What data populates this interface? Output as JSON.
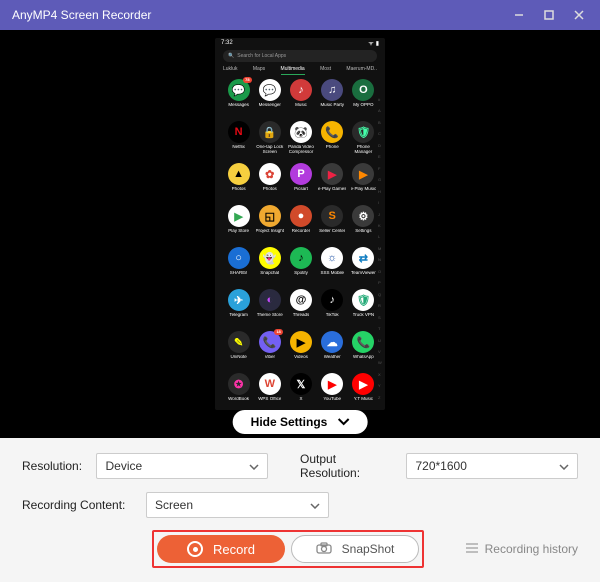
{
  "titlebar": {
    "title": "AnyMP4 Screen Recorder"
  },
  "phone": {
    "time": "7:32",
    "search_placeholder": "Search for Local Apps",
    "tabs": [
      "Lukluk",
      "Maps",
      "Multimedia",
      "Most",
      "Maerum-MD.."
    ],
    "active_tab": 2,
    "alpha_index": [
      "#",
      "A",
      "B",
      "C",
      "D",
      "E",
      "F",
      "G",
      "H",
      "I",
      "J",
      "K",
      "L",
      "M",
      "N",
      "O",
      "P",
      "Q",
      "R",
      "S",
      "T",
      "U",
      "V",
      "W",
      "X",
      "Y",
      "Z"
    ],
    "apps": [
      {
        "label": "Messages",
        "bg": "#1a9a4a",
        "txt": "💬",
        "badge": "78"
      },
      {
        "label": "Messenger",
        "bg": "#fff",
        "txt": "💬",
        "fg": "#1778f2"
      },
      {
        "label": "Music",
        "bg": "#d13a3a",
        "txt": "♪"
      },
      {
        "label": "Music Party",
        "bg": "#4a4a7e",
        "txt": "♫"
      },
      {
        "label": "My OPPO",
        "bg": "#1a6e3f",
        "txt": "O"
      },
      {
        "label": "Netflix",
        "bg": "#000",
        "txt": "N",
        "fg": "#e50914"
      },
      {
        "label": "One-tap Lock Screen",
        "bg": "#2a2a2a",
        "txt": "🔒"
      },
      {
        "label": "Panda Video Compressor",
        "bg": "#fff",
        "txt": "🐼",
        "fg": "#000"
      },
      {
        "label": "Phone",
        "bg": "#f6b400",
        "txt": "📞",
        "fg": "#000"
      },
      {
        "label": "Phone Manager",
        "bg": "#2a2a2a",
        "txt": "🛡",
        "fg": "#4fa"
      },
      {
        "label": "Photos",
        "bg": "#f6cf3f",
        "txt": "▲",
        "fg": "#000"
      },
      {
        "label": "Photos",
        "bg": "#fff",
        "txt": "✿",
        "fg": "#db4437"
      },
      {
        "label": "Picsart",
        "bg": "#b23bdd",
        "txt": "P"
      },
      {
        "label": "e·Play Games",
        "bg": "#3a3a3a",
        "txt": "▶",
        "fg": "#e24"
      },
      {
        "label": "e·Play Music",
        "bg": "#3a3a3a",
        "txt": "▶",
        "fg": "#f80"
      },
      {
        "label": "Play Store",
        "bg": "#fff",
        "txt": "▶",
        "fg": "#34a853"
      },
      {
        "label": "Project Insight",
        "bg": "#f0a930",
        "txt": "◱",
        "fg": "#000"
      },
      {
        "label": "Recorder",
        "bg": "#d14a2a",
        "txt": "●"
      },
      {
        "label": "Seller Center",
        "bg": "#2a2a2a",
        "txt": "S",
        "fg": "#f80"
      },
      {
        "label": "Settings",
        "bg": "#3a3a3a",
        "txt": "⚙"
      },
      {
        "label": "SHAREit",
        "bg": "#1a6ed4",
        "txt": "○"
      },
      {
        "label": "Snapchat",
        "bg": "#fffc00",
        "txt": "👻",
        "fg": "#000"
      },
      {
        "label": "Spotify",
        "bg": "#1db954",
        "txt": "♪",
        "fg": "#000"
      },
      {
        "label": "SSS Mobile",
        "bg": "#fff",
        "txt": "☼",
        "fg": "#1a4ea3"
      },
      {
        "label": "TeamViewer",
        "bg": "#fff",
        "txt": "⇄",
        "fg": "#0e7cc1"
      },
      {
        "label": "Telegram",
        "bg": "#2aa1da",
        "txt": "✈"
      },
      {
        "label": "Theme Store",
        "bg": "#2a2a3f",
        "txt": "◐",
        "fg": "#c64aff"
      },
      {
        "label": "Threads",
        "bg": "#fff",
        "txt": "@",
        "fg": "#000"
      },
      {
        "label": "TikTok",
        "bg": "#000",
        "txt": "♪"
      },
      {
        "label": "Truck VPN",
        "bg": "#fff",
        "txt": "🛡",
        "fg": "#2a7"
      },
      {
        "label": "UniNote",
        "bg": "#2a2a2a",
        "txt": "✎",
        "fg": "#ff0"
      },
      {
        "label": "Viber",
        "bg": "#7360f2",
        "txt": "📞",
        "badge": "18"
      },
      {
        "label": "Videos",
        "bg": "#f6b400",
        "txt": "▶",
        "fg": "#000"
      },
      {
        "label": "Weather",
        "bg": "#2a6edb",
        "txt": "☁"
      },
      {
        "label": "WhatsApp",
        "bg": "#25d366",
        "txt": "📞"
      },
      {
        "label": "WordBook",
        "bg": "#2a2a2a",
        "txt": "✪",
        "fg": "#f3a"
      },
      {
        "label": "WPS Office",
        "bg": "#fff",
        "txt": "W",
        "fg": "#d43"
      },
      {
        "label": "X",
        "bg": "#000",
        "txt": "𝕏"
      },
      {
        "label": "YouTube",
        "bg": "#fff",
        "txt": "▶",
        "fg": "#f00"
      },
      {
        "label": "Y.T Music",
        "bg": "#f00",
        "txt": "▶"
      }
    ]
  },
  "hide_settings_label": "Hide Settings",
  "settings": {
    "resolution_label": "Resolution:",
    "resolution_value": "Device",
    "output_label": "Output Resolution:",
    "output_value": "720*1600",
    "content_label": "Recording Content:",
    "content_value": "Screen"
  },
  "buttons": {
    "record": "Record",
    "snapshot": "SnapShot",
    "history": "Recording history"
  }
}
